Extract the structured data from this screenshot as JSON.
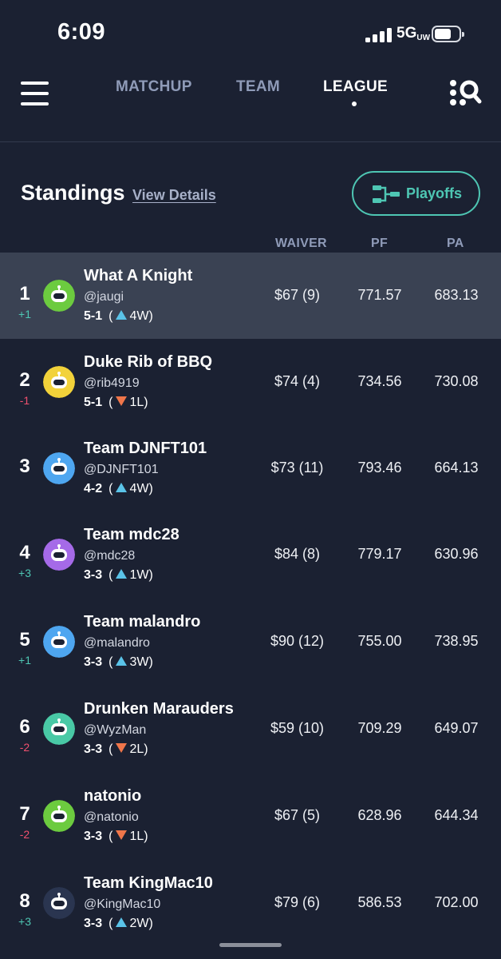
{
  "status_bar": {
    "time": "6:09",
    "network": "5G",
    "network_sub": "UW"
  },
  "nav": {
    "tabs": [
      {
        "label": "MATCHUP"
      },
      {
        "label": "TEAM"
      },
      {
        "label": "LEAGUE"
      }
    ],
    "active_tab": "LEAGUE"
  },
  "standings": {
    "title": "Standings",
    "view_details": "View Details",
    "playoffs_label": "Playoffs",
    "columns": {
      "waiver": "WAIVER",
      "pf": "PF",
      "pa": "PA"
    },
    "teams": [
      {
        "rank": "1",
        "change": "+1",
        "change_dir": "up",
        "name": "What A Knight",
        "handle": "@jaugi",
        "record": "5-1",
        "streak": "4W",
        "streak_dir": "up",
        "waiver": "$67 (9)",
        "pf": "771.57",
        "pa": "683.13",
        "avatar_color": "#6ccb3f"
      },
      {
        "rank": "2",
        "change": "-1",
        "change_dir": "down",
        "name": "Duke Rib of BBQ",
        "handle": "@rib4919",
        "record": "5-1",
        "streak": "1L",
        "streak_dir": "down",
        "waiver": "$74 (4)",
        "pf": "734.56",
        "pa": "730.08",
        "avatar_color": "#f2d23a"
      },
      {
        "rank": "3",
        "change": "",
        "change_dir": "none",
        "name": "Team DJNFT101",
        "handle": "@DJNFT101",
        "record": "4-2",
        "streak": "4W",
        "streak_dir": "up",
        "waiver": "$73 (11)",
        "pf": "793.46",
        "pa": "664.13",
        "avatar_color": "#4ea6f0"
      },
      {
        "rank": "4",
        "change": "+3",
        "change_dir": "up",
        "name": "Team mdc28",
        "handle": "@mdc28",
        "record": "3-3",
        "streak": "1W",
        "streak_dir": "up",
        "waiver": "$84 (8)",
        "pf": "779.17",
        "pa": "630.96",
        "avatar_color": "#a56ae8"
      },
      {
        "rank": "5",
        "change": "+1",
        "change_dir": "up",
        "name": "Team malandro",
        "handle": "@malandro",
        "record": "3-3",
        "streak": "3W",
        "streak_dir": "up",
        "waiver": "$90 (12)",
        "pf": "755.00",
        "pa": "738.95",
        "avatar_color": "#4ea6f0"
      },
      {
        "rank": "6",
        "change": "-2",
        "change_dir": "down",
        "name": "Drunken Marauders",
        "handle": "@WyzMan",
        "record": "3-3",
        "streak": "2L",
        "streak_dir": "down",
        "waiver": "$59 (10)",
        "pf": "709.29",
        "pa": "649.07",
        "avatar_color": "#49c9a6"
      },
      {
        "rank": "7",
        "change": "-2",
        "change_dir": "down",
        "name": "natonio",
        "handle": "@natonio",
        "record": "3-3",
        "streak": "1L",
        "streak_dir": "down",
        "waiver": "$67 (5)",
        "pf": "628.96",
        "pa": "644.34",
        "avatar_color": "#6ccb3f"
      },
      {
        "rank": "8",
        "change": "+3",
        "change_dir": "up",
        "name": "Team KingMac10",
        "handle": "@KingMac10",
        "record": "3-3",
        "streak": "2W",
        "streak_dir": "up",
        "waiver": "$79 (6)",
        "pf": "586.53",
        "pa": "702.00",
        "avatar_color": "#2a3550"
      }
    ]
  }
}
